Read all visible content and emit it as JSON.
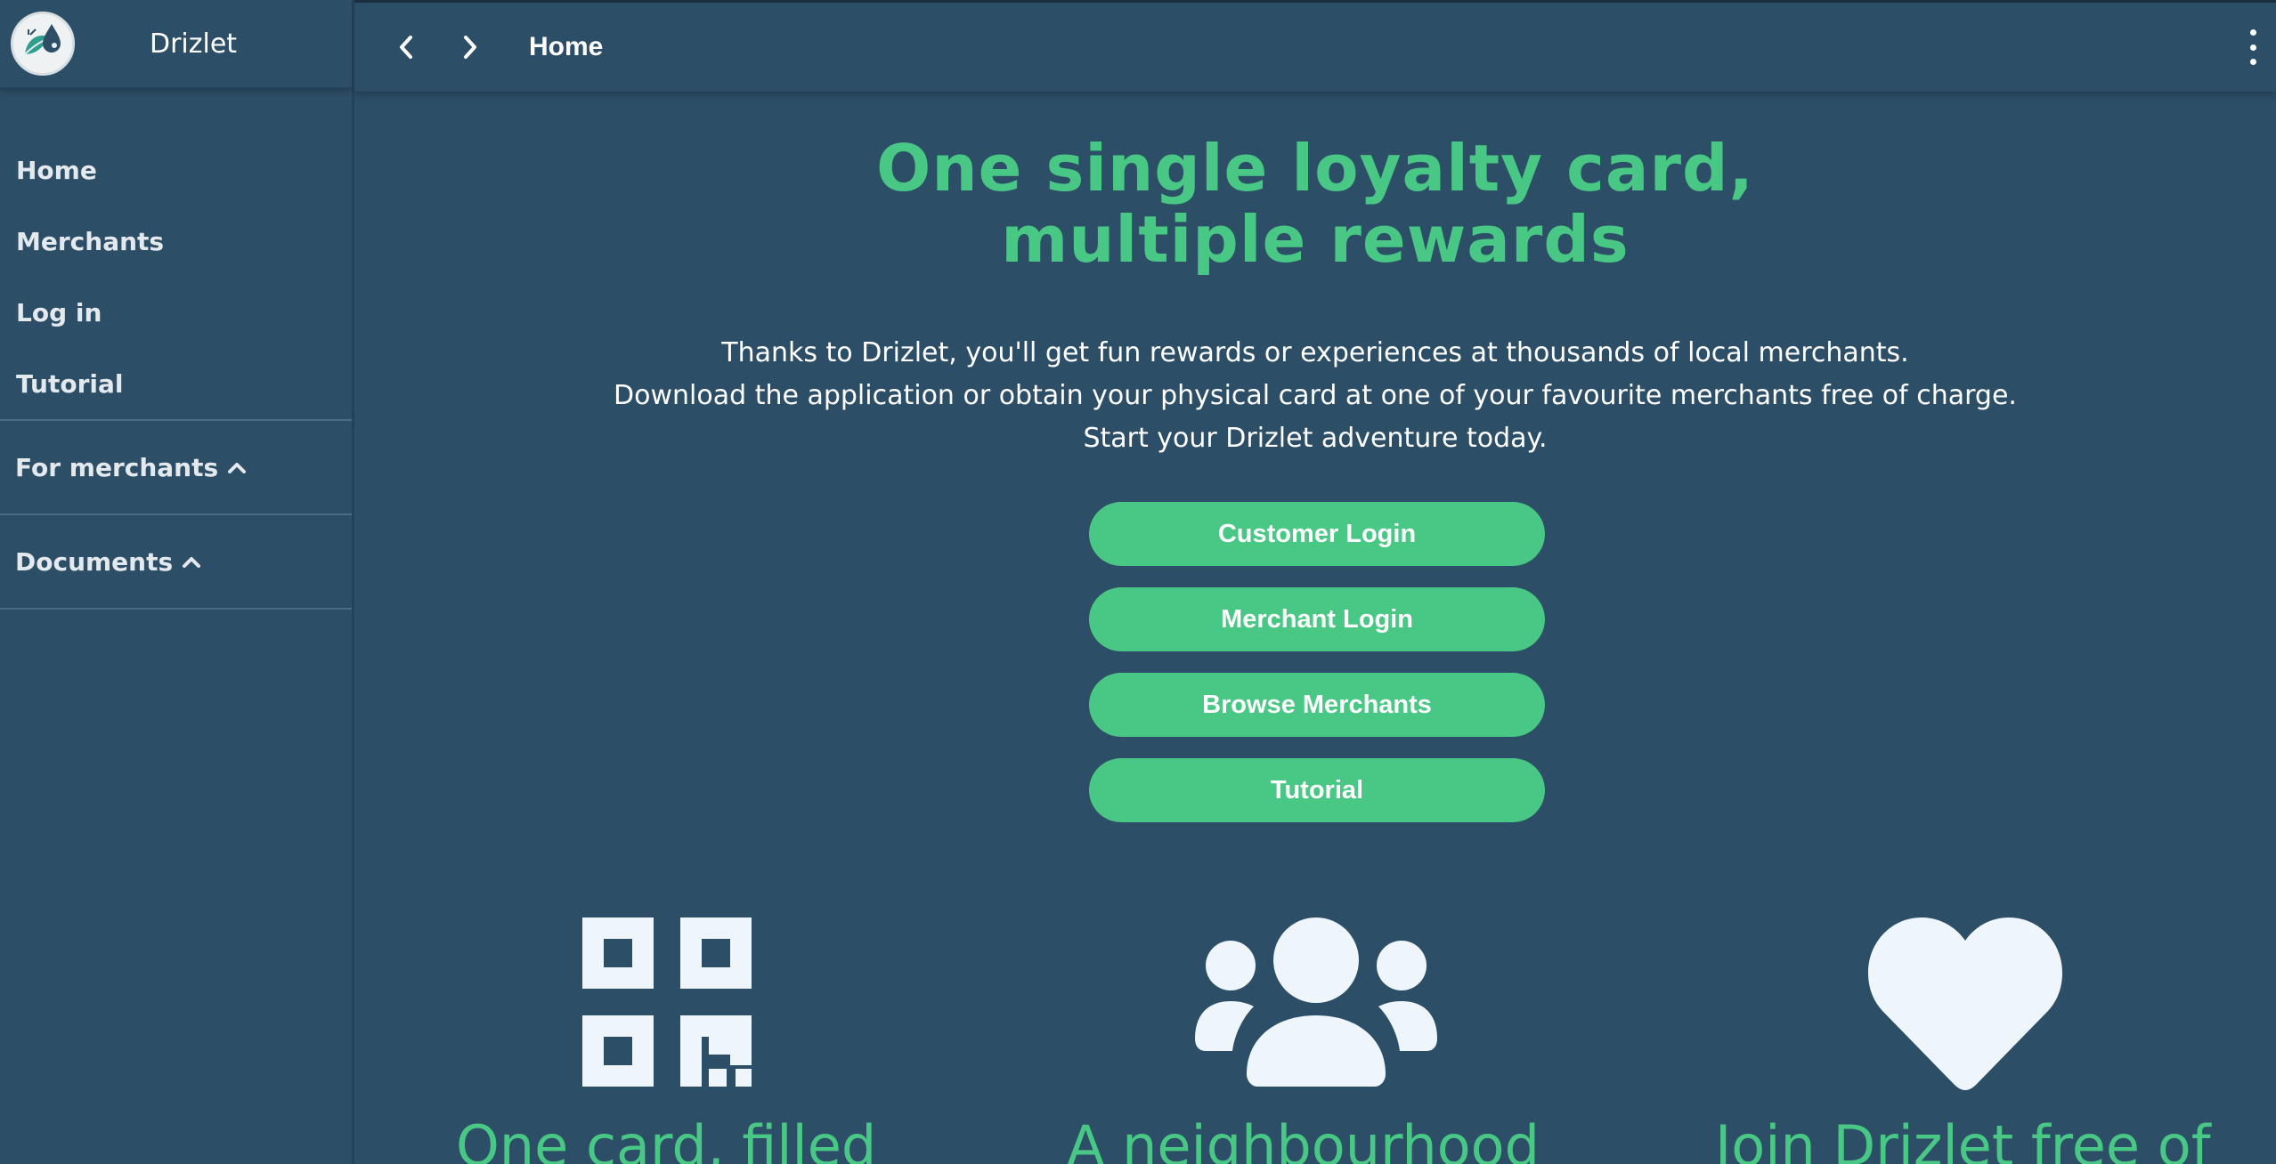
{
  "app": {
    "brand": "Drizlet"
  },
  "topbar": {
    "breadcrumb": "Home"
  },
  "sidebar": {
    "items": [
      {
        "label": "Home"
      },
      {
        "label": "Merchants"
      },
      {
        "label": "Log in"
      },
      {
        "label": "Tutorial"
      }
    ],
    "groups": [
      {
        "label": "For merchants"
      },
      {
        "label": "Documents"
      }
    ]
  },
  "hero": {
    "title_line1": "One single loyalty card,",
    "title_line2": "multiple rewards",
    "text_line1": "Thanks to Drizlet, you'll get fun rewards or experiences at thousands of local merchants.",
    "text_line2": "Download the application or obtain your physical card at one of your favourite merchants free of charge.",
    "text_line3": "Start your Drizlet adventure today."
  },
  "buttons": {
    "customer_login": "Customer Login",
    "merchant_login": "Merchant Login",
    "browse_merchants": "Browse Merchants",
    "tutorial": "Tutorial"
  },
  "features": [
    {
      "icon": "qr-code-icon",
      "title": "One card, filled"
    },
    {
      "icon": "users-icon",
      "title": "A neighbourhood"
    },
    {
      "icon": "heart-icon",
      "title": "Join Drizlet free of"
    }
  ],
  "colors": {
    "background": "#2d4e67",
    "accent": "#48c884",
    "icon": "#eef5fb"
  }
}
